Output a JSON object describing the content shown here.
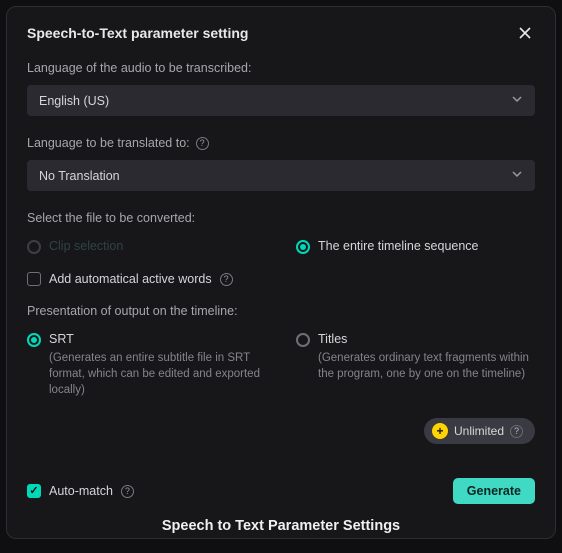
{
  "dialog": {
    "title": "Speech-to-Text parameter setting"
  },
  "audio_lang": {
    "label": "Language of the audio to be transcribed:",
    "value": "English (US)"
  },
  "translate_lang": {
    "label": "Language to be translated to:",
    "value": "No Translation"
  },
  "file_select": {
    "label": "Select the file to be converted:",
    "clip": "Clip selection",
    "timeline": "The entire timeline sequence"
  },
  "auto_words": {
    "label": "Add automatical active words"
  },
  "presentation": {
    "label": "Presentation of output on the timeline:",
    "srt": {
      "title": "SRT",
      "desc": "(Generates an entire subtitle file in SRT format, which can be edited and exported locally)"
    },
    "titles": {
      "title": "Titles",
      "desc": "(Generates ordinary text fragments within the program, one by one on the timeline)"
    }
  },
  "pill": {
    "label": "Unlimited"
  },
  "footer": {
    "auto_match": "Auto-match",
    "generate": "Generate"
  },
  "caption": "Speech to Text Parameter Settings"
}
